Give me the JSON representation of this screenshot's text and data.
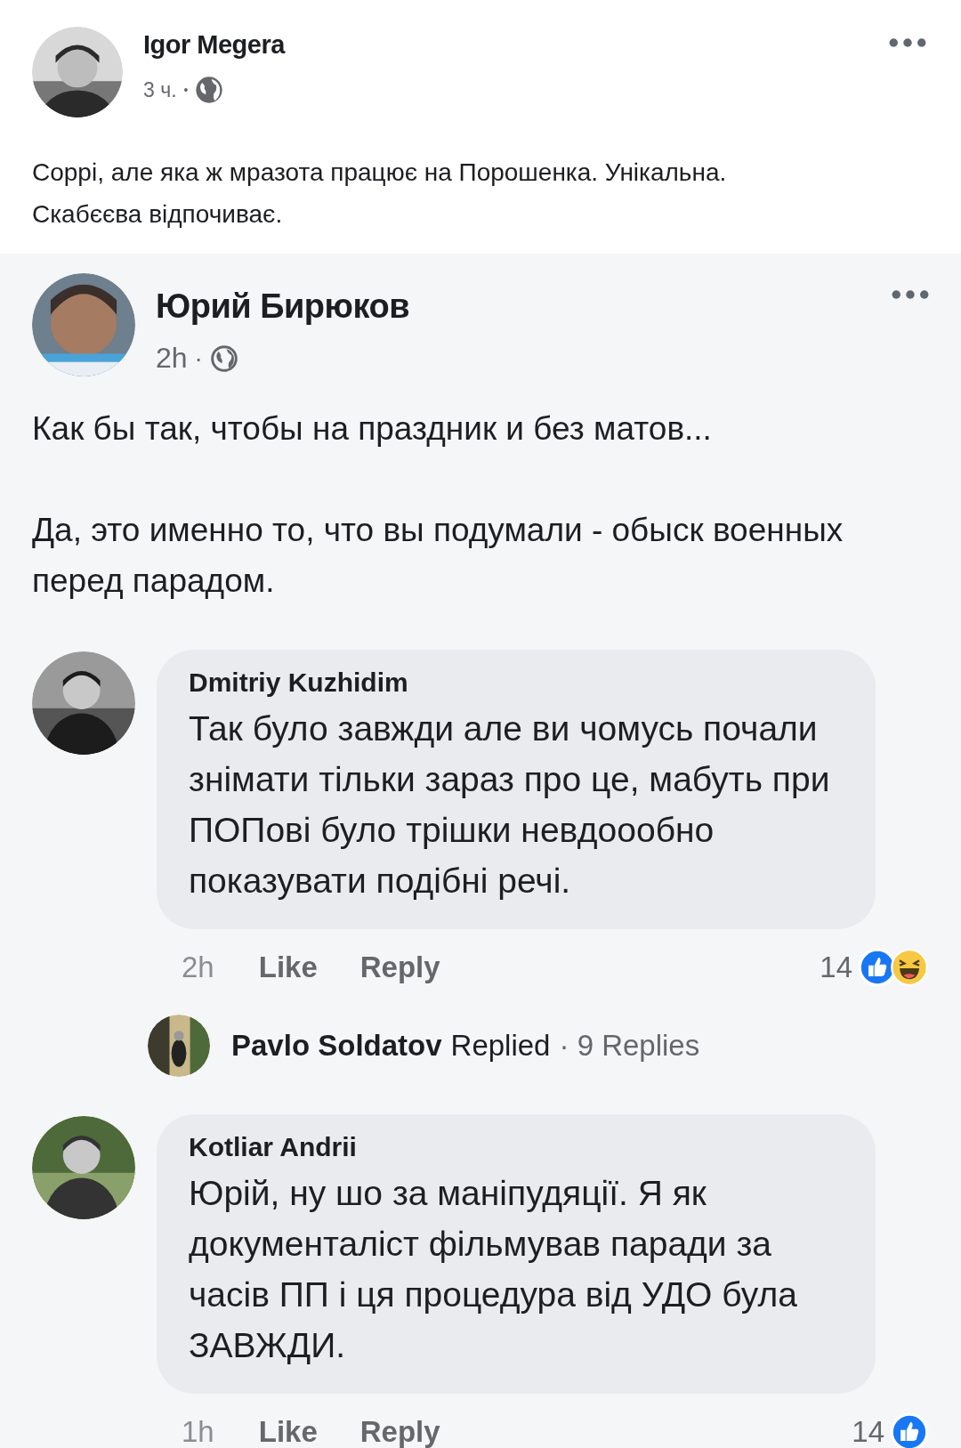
{
  "post": {
    "author": "Igor Megera",
    "avatar": {
      "kind": "picture"
    },
    "time": "3 ч.",
    "separator": "•",
    "text": [
      "Соррі, але яка ж мразота працює на Порошенка. Унікальна.",
      "Скабєєва відпочиває."
    ]
  },
  "shared_post": {
    "author": "Юрий Бирюков",
    "avatar": {
      "kind": "picture"
    },
    "time": "2h",
    "separator": "·",
    "paragraphs": [
      "Как бы так, чтобы на праздник и без матов...",
      "Да, это именно то, что вы подумали - обыск военных перед парадом."
    ]
  },
  "comments": [
    {
      "author": "Dmitriy Kuzhidim",
      "avatar": {
        "kind": "picture"
      },
      "text": "Так було завжди але ви чомусь почали знімати тільки зараз про це, мабуть при ПОПові було трішки невдоообно показувати подібні речі.",
      "time": "2h",
      "like": "Like",
      "reply": "Reply",
      "reaction_count": "14",
      "reactions": [
        {
          "kind": "like"
        },
        {
          "kind": "haha"
        }
      ],
      "replies_summary": {
        "avatar": {
          "kind": "picture"
        },
        "name": "Pavlo Soldatov",
        "action": "Replied",
        "count": "· 9 Replies"
      }
    },
    {
      "author": "Kotliar Andrii",
      "avatar": {
        "kind": "picture"
      },
      "text": "Юрій, ну шо за маніпудяції. Я як документаліст фільмував паради за часів ПП і ця процедура від УДО була ЗАВЖДИ.",
      "time": "1h",
      "like": "Like",
      "reply": "Reply",
      "reaction_count": "14",
      "reactions": [
        {
          "kind": "like"
        }
      ]
    }
  ]
}
